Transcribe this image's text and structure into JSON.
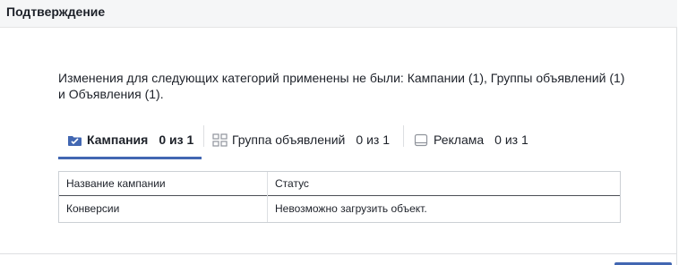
{
  "dialog": {
    "title": "Подтверждение",
    "message": "Изменения для следующих категорий применены не были: Кампании (1), Группы объявлений (1) и Объявления (1)."
  },
  "tabs": [
    {
      "label": "Кампания",
      "count": "0 из 1",
      "icon": "campaign-folder-icon",
      "active": true
    },
    {
      "label": "Группа объявлений",
      "count": "0 из 1",
      "icon": "ad-set-grid-icon",
      "active": false
    },
    {
      "label": "Реклама",
      "count": "0 из 1",
      "icon": "ad-monitor-icon",
      "active": false
    }
  ],
  "table": {
    "headers": [
      "Название кампании",
      "Статус"
    ],
    "rows": [
      [
        "Конверсии",
        "Невозможно загрузить объект."
      ]
    ]
  },
  "colors": {
    "accent": "#4267b2",
    "header_bg": "#f5f6f7",
    "border": "#ccd0d5"
  }
}
